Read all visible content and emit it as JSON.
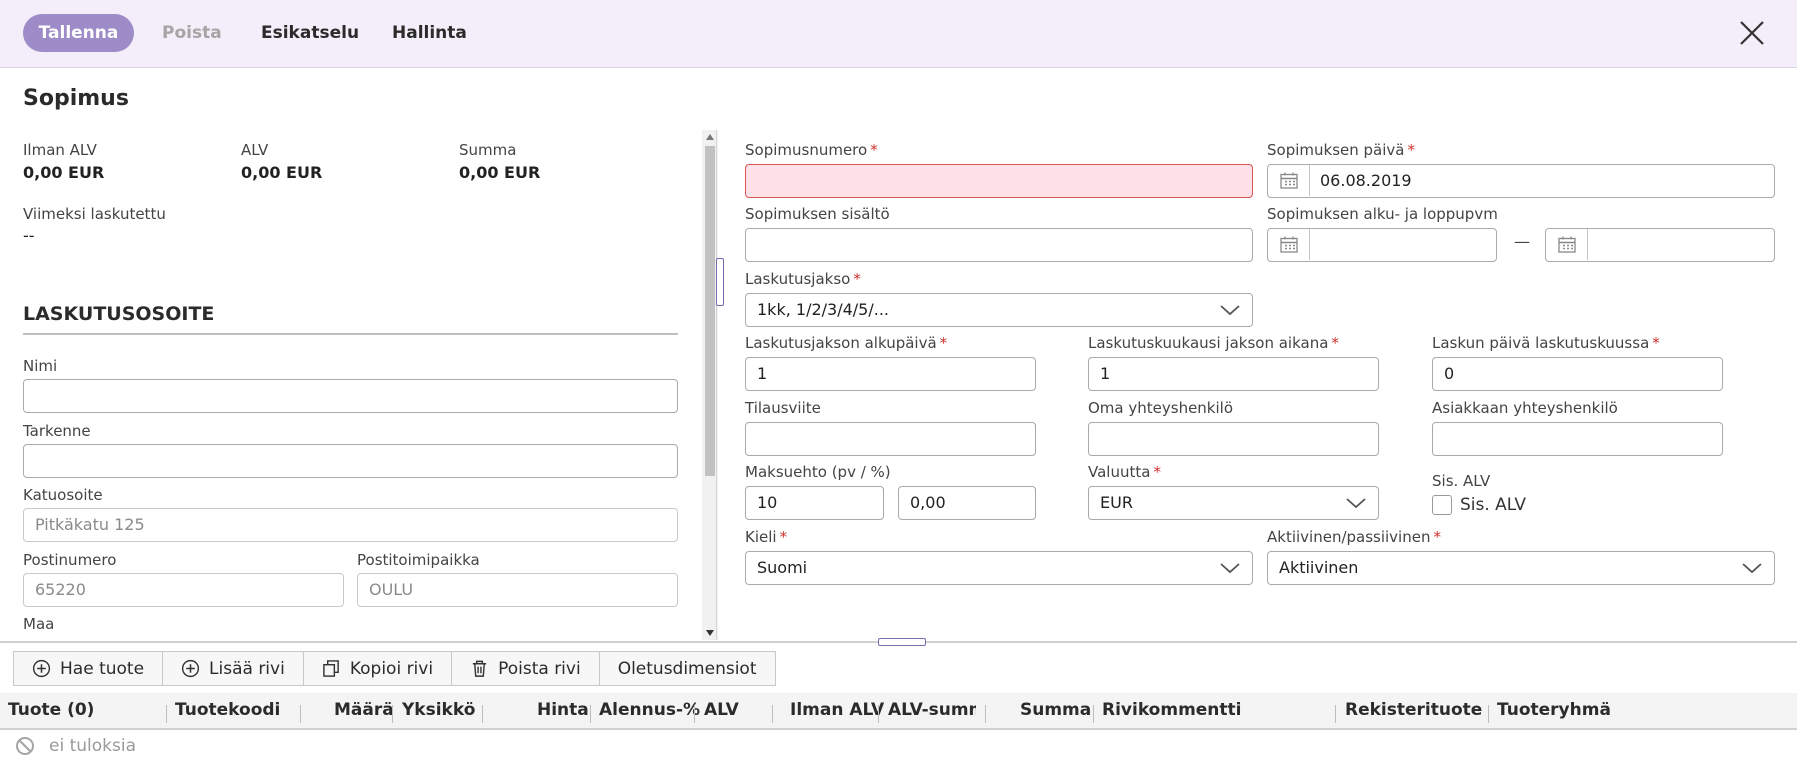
{
  "toolbar": {
    "save": "Tallenna",
    "delete": "Poista",
    "preview": "Esikatselu",
    "manage": "Hallinta"
  },
  "title": "Sopimus",
  "summary": {
    "ex_vat_label": "Ilman ALV",
    "ex_vat_value": "0,00 EUR",
    "vat_label": "ALV",
    "vat_value": "0,00 EUR",
    "total_label": "Summa",
    "total_value": "0,00 EUR",
    "last_billed_label": "Viimeksi laskutettu",
    "last_billed_value": "--"
  },
  "billing_address": {
    "heading": "LASKUTUSOSOITE",
    "name_label": "Nimi",
    "name_value": "",
    "specifier_label": "Tarkenne",
    "specifier_value": "",
    "street_label": "Katuosoite",
    "street_value": "Pitkäkatu 125",
    "zip_label": "Postinumero",
    "zip_value": "65220",
    "city_label": "Postitoimipaikka",
    "city_value": "OULU",
    "country_label": "Maa"
  },
  "form": {
    "contract_number_label": "Sopimusnumero",
    "contract_number_value": "",
    "contract_date_label": "Sopimuksen päivä",
    "contract_date_value": "06.08.2019",
    "content_label": "Sopimuksen sisältö",
    "content_value": "",
    "period_label": "Sopimuksen alku- ja loppupvm",
    "period_start": "",
    "period_end": "",
    "period_dash": "—",
    "billing_cycle_label": "Laskutusjakso",
    "billing_cycle_value": "1kk, 1/2/3/4/5/...",
    "cycle_start_day_label": "Laskutusjakson alkupäivä",
    "cycle_start_day_value": "1",
    "billing_month_label": "Laskutuskuukausi jakson aikana",
    "billing_month_value": "1",
    "invoice_day_label": "Laskun päivä laskutuskuussa",
    "invoice_day_value": "0",
    "order_ref_label": "Tilausviite",
    "order_ref_value": "",
    "own_contact_label": "Oma yhteyshenkilö",
    "own_contact_value": "",
    "customer_contact_label": "Asiakkaan yhteyshenkilö",
    "customer_contact_value": "",
    "payment_terms_label": "Maksuehto (pv / %)",
    "payment_days_value": "10",
    "payment_pct_value": "0,00",
    "currency_label": "Valuutta",
    "currency_value": "EUR",
    "incl_vat_label": "Sis. ALV",
    "incl_vat_checkbox_label": "Sis. ALV",
    "incl_vat_checked": false,
    "language_label": "Kieli",
    "language_value": "Suomi",
    "status_label": "Aktiivinen/passiivinen",
    "status_value": "Aktiivinen"
  },
  "grid": {
    "buttons": [
      "Hae tuote",
      "Lisää rivi",
      "Kopioi rivi",
      "Poista rivi",
      "Oletusdimensiot"
    ],
    "columns": [
      "Tuote (0)",
      "Tuotekoodi",
      "Määrä",
      "Yksikkö",
      "Hinta",
      "Alennus-%",
      "ALV",
      "Ilman ALV",
      "ALV-summa",
      "Summa",
      "Rivikommentti",
      "Rekisterituote",
      "Tuoteryhmä"
    ],
    "empty_text": "ei tuloksia"
  },
  "colors": {
    "accent": "#9d8cc8",
    "toolbar_bg": "#f3eef9",
    "error_bg": "#fde0e8",
    "required": "#d0312d"
  }
}
